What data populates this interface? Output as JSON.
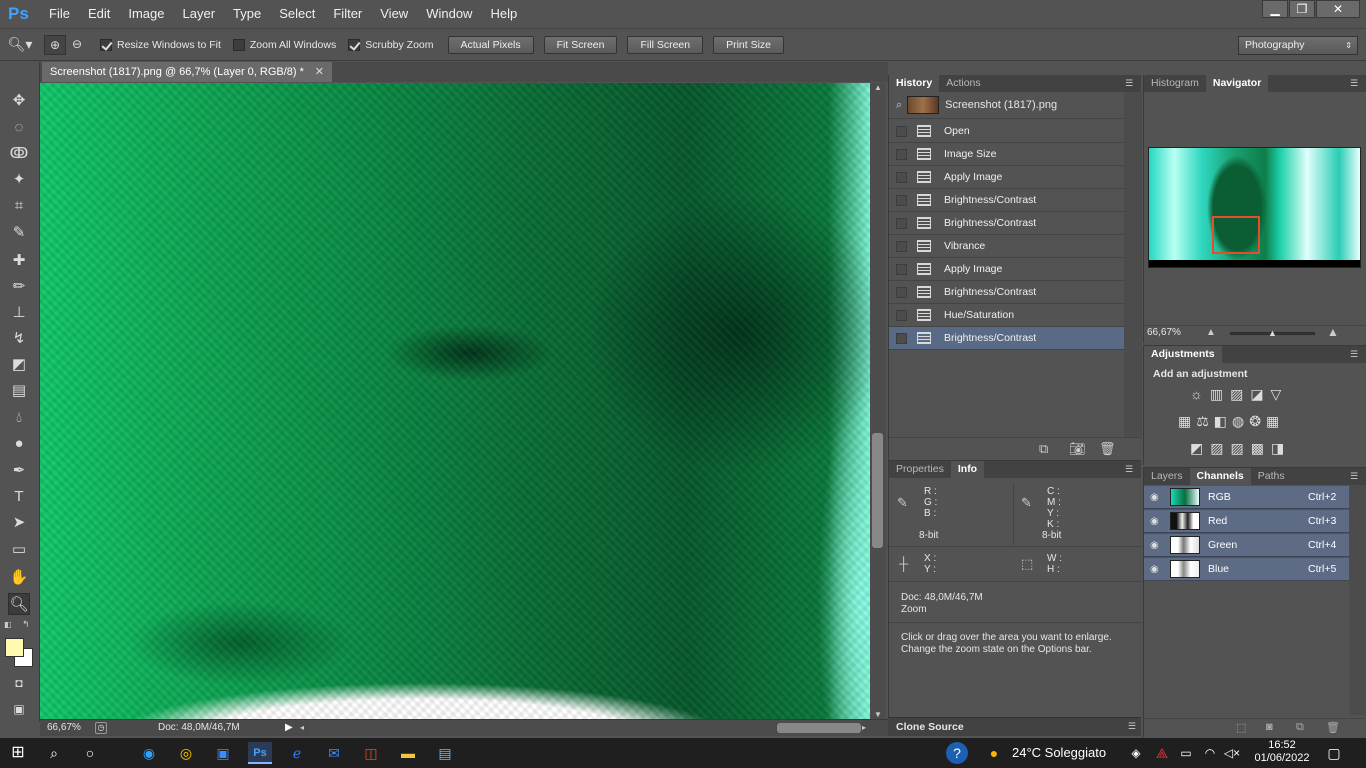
{
  "menubar": {
    "logo": "Ps",
    "items": [
      "File",
      "Edit",
      "Image",
      "Layer",
      "Type",
      "Select",
      "Filter",
      "View",
      "Window",
      "Help"
    ],
    "window_buttons": {
      "minimize": "▁",
      "restore": "❐",
      "close": "✕"
    }
  },
  "options": {
    "tool_icon": "zoom-icon",
    "resize_windows_to_fit": {
      "label": "Resize Windows to Fit",
      "checked": true
    },
    "zoom_all_windows": {
      "label": "Zoom All Windows",
      "checked": false
    },
    "scrubby_zoom": {
      "label": "Scrubby Zoom",
      "checked": true
    },
    "buttons": [
      "Actual Pixels",
      "Fit Screen",
      "Fill Screen",
      "Print Size"
    ],
    "workspace": "Photography"
  },
  "document": {
    "tab_title": "Screenshot (1817).png @ 66,7% (Layer 0, RGB/8) *",
    "zoom": "66,67%",
    "doc_size": "Doc: 48,0M/46,7M"
  },
  "history": {
    "tabs": [
      "History",
      "Actions"
    ],
    "snapshot_name": "Screenshot (1817).png",
    "steps": [
      "Open",
      "Image Size",
      "Apply Image",
      "Brightness/Contrast",
      "Brightness/Contrast",
      "Vibrance",
      "Apply Image",
      "Brightness/Contrast",
      "Hue/Saturation",
      "Brightness/Contrast"
    ],
    "selected_index": 9
  },
  "info": {
    "tabs": [
      "Properties",
      "Info"
    ],
    "rgb_labels": [
      "R :",
      "G :",
      "B :"
    ],
    "cmyk_labels": [
      "C :",
      "M :",
      "Y :",
      "K :"
    ],
    "bitdepth_left": "8-bit",
    "bitdepth_right": "8-bit",
    "xy_labels": [
      "X :",
      "Y :"
    ],
    "wh_labels": [
      "W :",
      "H :"
    ],
    "doc": "Doc: 48,0M/46,7M",
    "tool": "Zoom",
    "hint": "Click or drag over the area you want to enlarge. Change the zoom state on the Options bar."
  },
  "clone_source": {
    "label": "Clone Source"
  },
  "navigator": {
    "tabs": [
      "Histogram",
      "Navigator"
    ],
    "zoom": "66,67%"
  },
  "adjustments": {
    "title": "Adjustments",
    "subtitle": "Add an adjustment"
  },
  "channels": {
    "tabs": [
      "Layers",
      "Channels",
      "Paths"
    ],
    "rows": [
      {
        "name": "RGB",
        "shortcut": "Ctrl+2"
      },
      {
        "name": "Red",
        "shortcut": "Ctrl+3"
      },
      {
        "name": "Green",
        "shortcut": "Ctrl+4"
      },
      {
        "name": "Blue",
        "shortcut": "Ctrl+5"
      }
    ]
  },
  "taskbar": {
    "weather": "24°C  Soleggiato",
    "time": "16:52",
    "date": "01/06/2022"
  },
  "colors": {
    "panel_bg": "#535353",
    "selection": "#596a86",
    "accent_ps": "#3fa3ff"
  }
}
